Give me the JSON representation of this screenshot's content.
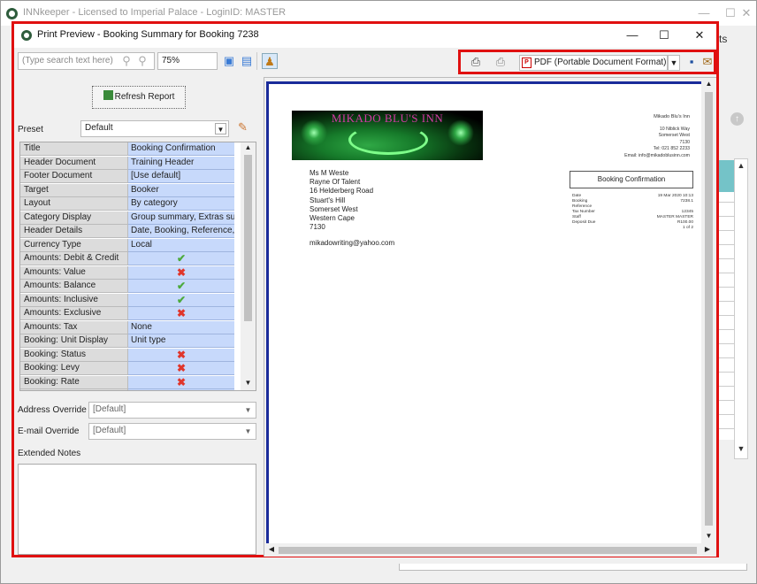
{
  "main_window": {
    "title": "INNkeeper - Licensed to Imperial Palace - LoginID: MASTER",
    "bg_label": "ts"
  },
  "dialog": {
    "title": "Print Preview - Booking Summary for Booking 7238"
  },
  "toolbar": {
    "search_placeholder": "(Type search text here)",
    "zoom_value": "75%",
    "export_format": "PDF (Portable Document Format)"
  },
  "left": {
    "refresh_label": "Refresh Report",
    "preset_label": "Preset",
    "preset_value": "Default",
    "properties": [
      {
        "key": "Title",
        "value": "Booking Confirmation",
        "kind": "text"
      },
      {
        "key": "Header Document",
        "value": "Training Header",
        "kind": "text"
      },
      {
        "key": "Footer Document",
        "value": "[Use default]",
        "kind": "text"
      },
      {
        "key": "Target",
        "value": "Booker",
        "kind": "text"
      },
      {
        "key": "Layout",
        "value": "By category",
        "kind": "text"
      },
      {
        "key": "Category Display",
        "value": "Group summary, Extras summ",
        "kind": "text"
      },
      {
        "key": "Header Details",
        "value": "Date, Booking, Reference, S",
        "kind": "text"
      },
      {
        "key": "Currency Type",
        "value": "Local",
        "kind": "text"
      },
      {
        "key": "Amounts: Debit & Credit",
        "value": "",
        "kind": "yes"
      },
      {
        "key": "Amounts: Value",
        "value": "",
        "kind": "no"
      },
      {
        "key": "Amounts: Balance",
        "value": "",
        "kind": "yes"
      },
      {
        "key": "Amounts: Inclusive",
        "value": "",
        "kind": "yes"
      },
      {
        "key": "Amounts: Exclusive",
        "value": "",
        "kind": "no"
      },
      {
        "key": "Amounts: Tax",
        "value": "None",
        "kind": "text"
      },
      {
        "key": "Booking: Unit Display",
        "value": "Unit type",
        "kind": "text"
      },
      {
        "key": "Booking: Status",
        "value": "",
        "kind": "no"
      },
      {
        "key": "Booking: Levy",
        "value": "",
        "kind": "no"
      },
      {
        "key": "Booking: Rate",
        "value": "",
        "kind": "no"
      }
    ],
    "address_override_label": "Address Override",
    "address_override_value": "[Default]",
    "email_override_label": "E-mail Override",
    "email_override_value": "[Default]",
    "extended_notes_label": "Extended Notes"
  },
  "preview": {
    "logo_text": "MIKADO BLU'S INN",
    "address_lines": [
      "Ms M Weste",
      "Rayne Of Talent",
      "16 Helderberg Road",
      "Stuart's Hill",
      "Somerset West",
      "Western Cape",
      "7130"
    ],
    "email": "mikadowriting@yahoo.com",
    "company_name": "Mikado Blu's Inn",
    "company_lines": [
      "10 Niblick Way",
      "Somerset West",
      "7130",
      "Tel: 021 852 2233",
      "Email: info@mikadoblusinn.com"
    ],
    "doc_title": "Booking Confirmation",
    "meta": [
      {
        "label": "Date",
        "value": "19 Mar 2020 10:13"
      },
      {
        "label": "Booking",
        "value": "7238.1"
      },
      {
        "label": "Reference",
        "value": ""
      },
      {
        "label": "Tax Number",
        "value": "12345"
      },
      {
        "label": "Staff",
        "value": "MASTER MASTER"
      },
      {
        "label": "Deposit Due",
        "value": "R100.00"
      },
      {
        "label": "",
        "value": "1 of 2"
      }
    ]
  },
  "icons": {
    "yes": "✔",
    "no": "✖"
  },
  "colors": {
    "highlight_border": "#e01010",
    "yes": "#4caa3c",
    "no": "#e0362b",
    "value_cell": "#c7d9fb"
  }
}
